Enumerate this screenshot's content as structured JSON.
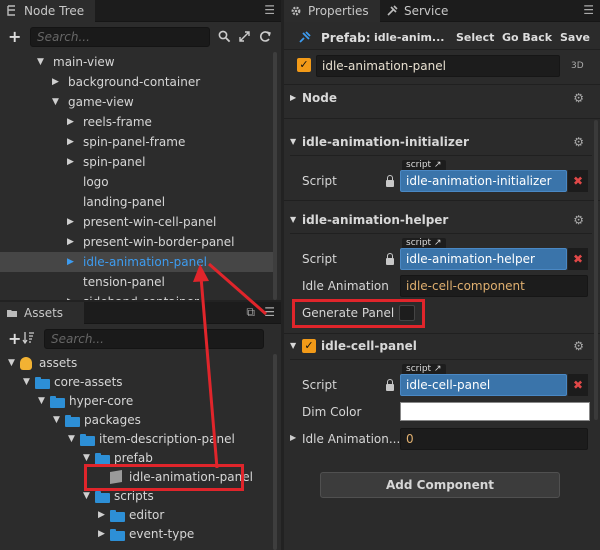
{
  "node_tree": {
    "tab_label": "Node Tree",
    "search_placeholder": "Search...",
    "items": [
      {
        "label": "main-view",
        "depth": 0,
        "expanded": true,
        "has_children": true,
        "selected": false
      },
      {
        "label": "background-container",
        "depth": 1,
        "expanded": false,
        "has_children": true,
        "selected": false
      },
      {
        "label": "game-view",
        "depth": 1,
        "expanded": true,
        "has_children": true,
        "selected": false
      },
      {
        "label": "reels-frame",
        "depth": 2,
        "expanded": false,
        "has_children": true,
        "selected": false
      },
      {
        "label": "spin-panel-frame",
        "depth": 2,
        "expanded": false,
        "has_children": true,
        "selected": false
      },
      {
        "label": "spin-panel",
        "depth": 2,
        "expanded": false,
        "has_children": true,
        "selected": false
      },
      {
        "label": "logo",
        "depth": 2,
        "expanded": false,
        "has_children": false,
        "selected": false
      },
      {
        "label": "landing-panel",
        "depth": 2,
        "expanded": false,
        "has_children": false,
        "selected": false
      },
      {
        "label": "present-win-cell-panel",
        "depth": 2,
        "expanded": false,
        "has_children": true,
        "selected": false
      },
      {
        "label": "present-win-border-panel",
        "depth": 2,
        "expanded": false,
        "has_children": true,
        "selected": false
      },
      {
        "label": "idle-animation-panel",
        "depth": 2,
        "expanded": false,
        "has_children": true,
        "selected": true
      },
      {
        "label": "tension-panel",
        "depth": 2,
        "expanded": false,
        "has_children": false,
        "selected": false
      },
      {
        "label": "sideband-container",
        "depth": 2,
        "expanded": false,
        "has_children": true,
        "selected": false
      }
    ]
  },
  "assets": {
    "tab_label": "Assets",
    "search_placeholder": "Search...",
    "items": [
      {
        "label": "assets",
        "depth": 0,
        "kind": "db"
      },
      {
        "label": "core-assets",
        "depth": 1,
        "kind": "folder"
      },
      {
        "label": "hyper-core",
        "depth": 2,
        "kind": "folder"
      },
      {
        "label": "packages",
        "depth": 3,
        "kind": "folder"
      },
      {
        "label": "item-description-panel",
        "depth": 4,
        "kind": "folder"
      },
      {
        "label": "prefab",
        "depth": 5,
        "kind": "folder"
      },
      {
        "label": "idle-animation-panel",
        "depth": 6,
        "kind": "prefab"
      },
      {
        "label": "scripts",
        "depth": 5,
        "kind": "folder"
      },
      {
        "label": "editor",
        "depth": 6,
        "kind": "folder"
      },
      {
        "label": "event-type",
        "depth": 6,
        "kind": "folder"
      }
    ]
  },
  "properties": {
    "tab_label": "Properties",
    "service_tab_label": "Service",
    "prefab_label": "Prefab:",
    "prefab_name": "idle-anim...",
    "select_label": "Select",
    "go_back_label": "Go Back",
    "save_label": "Save",
    "node_name": "idle-animation-panel",
    "mode_label": "3D",
    "node_section": "Node",
    "components": [
      {
        "title": "idle-animation-initializer",
        "script_label": "Script",
        "script_badge": "script",
        "script_value": "idle-animation-initializer"
      },
      {
        "title": "idle-animation-helper",
        "script_label": "Script",
        "script_badge": "script",
        "script_value": "idle-animation-helper",
        "idle_animation_label": "Idle Animation",
        "idle_animation_value": "idle-cell-component",
        "generate_panel_label": "Generate Panel"
      },
      {
        "title": "idle-cell-panel",
        "script_label": "Script",
        "script_badge": "script",
        "script_value": "idle-cell-panel",
        "dim_color_label": "Dim Color",
        "idle_animation_label": "Idle Animation...",
        "idle_animation_value": "0"
      }
    ],
    "add_component_label": "Add Component"
  },
  "colors": {
    "accent_blue": "#3d9cf0",
    "annotation_red": "#e0252b",
    "checkbox_orange": "#f29a18"
  }
}
